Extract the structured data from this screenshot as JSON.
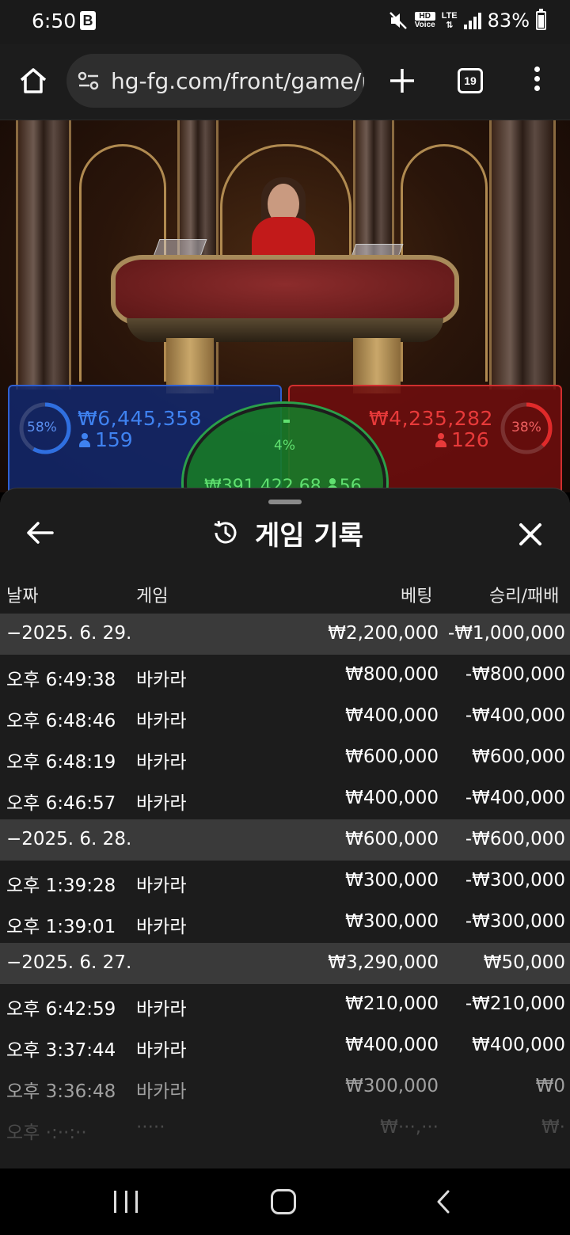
{
  "status_bar": {
    "time": "6:50",
    "notification_icon": "B",
    "hd_label": "HD",
    "voice_label": "Voice",
    "network": "LTE",
    "battery": "83%"
  },
  "browser": {
    "url": "hg-fg.com/front/game/p",
    "tab_count": "19"
  },
  "game": {
    "player": {
      "percent": "58%",
      "amount": "₩6,445,358",
      "bettors": "159",
      "fill": 0.58
    },
    "banker": {
      "percent": "38%",
      "amount": "₩4,235,282",
      "bettors": "126",
      "fill": 0.38
    },
    "tie": {
      "percent": "4%",
      "amount": "₩391,422.68",
      "bettors": "56",
      "fill": 0.04
    },
    "colors": {
      "player": "#2f6fe0",
      "banker": "#e02a2a",
      "tie": "#3fcf5a"
    }
  },
  "history": {
    "title": "게임 기록",
    "columns": {
      "date": "날짜",
      "game": "게임",
      "bet": "베팅",
      "result": "승리/패배"
    },
    "rows": [
      {
        "time": "−2025. 6. 29.",
        "game": "",
        "bet": "₩2,200,000",
        "result": "-₩1,000,000"
      },
      {
        "time": "오후 6:49:38",
        "game": "바카라",
        "bet": "₩800,000",
        "result": "-₩800,000"
      },
      {
        "time": "오후 6:48:46",
        "game": "바카라",
        "bet": "₩400,000",
        "result": "-₩400,000"
      },
      {
        "time": "오후 6:48:19",
        "game": "바카라",
        "bet": "₩600,000",
        "result": "₩600,000"
      },
      {
        "time": "오후 6:46:57",
        "game": "바카라",
        "bet": "₩400,000",
        "result": "-₩400,000"
      },
      {
        "time": "−2025. 6. 28.",
        "game": "",
        "bet": "₩600,000",
        "result": "-₩600,000"
      },
      {
        "time": "오후 1:39:28",
        "game": "바카라",
        "bet": "₩300,000",
        "result": "-₩300,000"
      },
      {
        "time": "오후 1:39:01",
        "game": "바카라",
        "bet": "₩300,000",
        "result": "-₩300,000"
      },
      {
        "time": "−2025. 6. 27.",
        "game": "",
        "bet": "₩3,290,000",
        "result": "₩50,000"
      },
      {
        "time": "오후 6:42:59",
        "game": "바카라",
        "bet": "₩210,000",
        "result": "-₩210,000"
      },
      {
        "time": "오후 3:37:44",
        "game": "바카라",
        "bet": "₩400,000",
        "result": "₩400,000"
      },
      {
        "time": "오후 3:36:48",
        "game": "바카라",
        "bet": "₩300,000",
        "result": "₩0"
      }
    ]
  }
}
